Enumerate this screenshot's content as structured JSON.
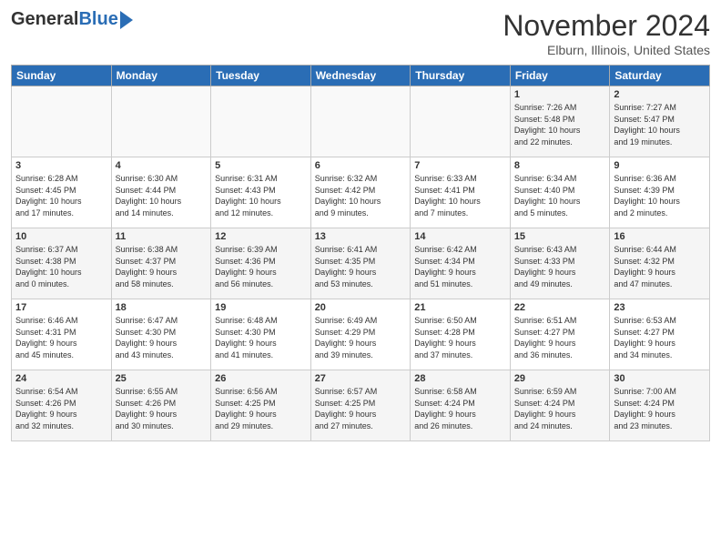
{
  "header": {
    "logo_general": "General",
    "logo_blue": "Blue",
    "month_title": "November 2024",
    "location": "Elburn, Illinois, United States"
  },
  "days_of_week": [
    "Sunday",
    "Monday",
    "Tuesday",
    "Wednesday",
    "Thursday",
    "Friday",
    "Saturday"
  ],
  "weeks": [
    [
      {
        "day": "",
        "info": ""
      },
      {
        "day": "",
        "info": ""
      },
      {
        "day": "",
        "info": ""
      },
      {
        "day": "",
        "info": ""
      },
      {
        "day": "",
        "info": ""
      },
      {
        "day": "1",
        "info": "Sunrise: 7:26 AM\nSunset: 5:48 PM\nDaylight: 10 hours\nand 22 minutes."
      },
      {
        "day": "2",
        "info": "Sunrise: 7:27 AM\nSunset: 5:47 PM\nDaylight: 10 hours\nand 19 minutes."
      }
    ],
    [
      {
        "day": "3",
        "info": "Sunrise: 6:28 AM\nSunset: 4:45 PM\nDaylight: 10 hours\nand 17 minutes."
      },
      {
        "day": "4",
        "info": "Sunrise: 6:30 AM\nSunset: 4:44 PM\nDaylight: 10 hours\nand 14 minutes."
      },
      {
        "day": "5",
        "info": "Sunrise: 6:31 AM\nSunset: 4:43 PM\nDaylight: 10 hours\nand 12 minutes."
      },
      {
        "day": "6",
        "info": "Sunrise: 6:32 AM\nSunset: 4:42 PM\nDaylight: 10 hours\nand 9 minutes."
      },
      {
        "day": "7",
        "info": "Sunrise: 6:33 AM\nSunset: 4:41 PM\nDaylight: 10 hours\nand 7 minutes."
      },
      {
        "day": "8",
        "info": "Sunrise: 6:34 AM\nSunset: 4:40 PM\nDaylight: 10 hours\nand 5 minutes."
      },
      {
        "day": "9",
        "info": "Sunrise: 6:36 AM\nSunset: 4:39 PM\nDaylight: 10 hours\nand 2 minutes."
      }
    ],
    [
      {
        "day": "10",
        "info": "Sunrise: 6:37 AM\nSunset: 4:38 PM\nDaylight: 10 hours\nand 0 minutes."
      },
      {
        "day": "11",
        "info": "Sunrise: 6:38 AM\nSunset: 4:37 PM\nDaylight: 9 hours\nand 58 minutes."
      },
      {
        "day": "12",
        "info": "Sunrise: 6:39 AM\nSunset: 4:36 PM\nDaylight: 9 hours\nand 56 minutes."
      },
      {
        "day": "13",
        "info": "Sunrise: 6:41 AM\nSunset: 4:35 PM\nDaylight: 9 hours\nand 53 minutes."
      },
      {
        "day": "14",
        "info": "Sunrise: 6:42 AM\nSunset: 4:34 PM\nDaylight: 9 hours\nand 51 minutes."
      },
      {
        "day": "15",
        "info": "Sunrise: 6:43 AM\nSunset: 4:33 PM\nDaylight: 9 hours\nand 49 minutes."
      },
      {
        "day": "16",
        "info": "Sunrise: 6:44 AM\nSunset: 4:32 PM\nDaylight: 9 hours\nand 47 minutes."
      }
    ],
    [
      {
        "day": "17",
        "info": "Sunrise: 6:46 AM\nSunset: 4:31 PM\nDaylight: 9 hours\nand 45 minutes."
      },
      {
        "day": "18",
        "info": "Sunrise: 6:47 AM\nSunset: 4:30 PM\nDaylight: 9 hours\nand 43 minutes."
      },
      {
        "day": "19",
        "info": "Sunrise: 6:48 AM\nSunset: 4:30 PM\nDaylight: 9 hours\nand 41 minutes."
      },
      {
        "day": "20",
        "info": "Sunrise: 6:49 AM\nSunset: 4:29 PM\nDaylight: 9 hours\nand 39 minutes."
      },
      {
        "day": "21",
        "info": "Sunrise: 6:50 AM\nSunset: 4:28 PM\nDaylight: 9 hours\nand 37 minutes."
      },
      {
        "day": "22",
        "info": "Sunrise: 6:51 AM\nSunset: 4:27 PM\nDaylight: 9 hours\nand 36 minutes."
      },
      {
        "day": "23",
        "info": "Sunrise: 6:53 AM\nSunset: 4:27 PM\nDaylight: 9 hours\nand 34 minutes."
      }
    ],
    [
      {
        "day": "24",
        "info": "Sunrise: 6:54 AM\nSunset: 4:26 PM\nDaylight: 9 hours\nand 32 minutes."
      },
      {
        "day": "25",
        "info": "Sunrise: 6:55 AM\nSunset: 4:26 PM\nDaylight: 9 hours\nand 30 minutes."
      },
      {
        "day": "26",
        "info": "Sunrise: 6:56 AM\nSunset: 4:25 PM\nDaylight: 9 hours\nand 29 minutes."
      },
      {
        "day": "27",
        "info": "Sunrise: 6:57 AM\nSunset: 4:25 PM\nDaylight: 9 hours\nand 27 minutes."
      },
      {
        "day": "28",
        "info": "Sunrise: 6:58 AM\nSunset: 4:24 PM\nDaylight: 9 hours\nand 26 minutes."
      },
      {
        "day": "29",
        "info": "Sunrise: 6:59 AM\nSunset: 4:24 PM\nDaylight: 9 hours\nand 24 minutes."
      },
      {
        "day": "30",
        "info": "Sunrise: 7:00 AM\nSunset: 4:24 PM\nDaylight: 9 hours\nand 23 minutes."
      }
    ]
  ]
}
